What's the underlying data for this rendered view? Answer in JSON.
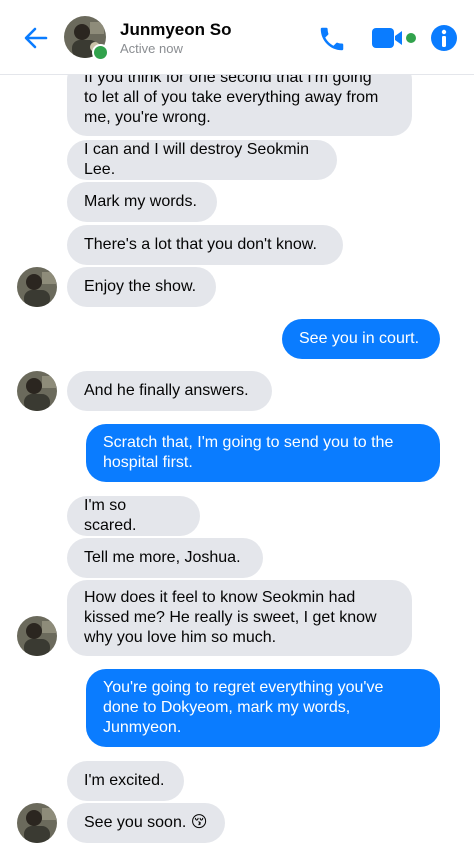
{
  "header": {
    "name": "Junmyeon So",
    "status": "Active now",
    "back_icon": "back-arrow-icon",
    "call_icon": "phone-icon",
    "video_icon": "video-camera-icon",
    "info_icon": "info-icon"
  },
  "colors": {
    "accent": "#0a7cff",
    "incoming_bubble": "#e4e6eb",
    "online": "#31a24c"
  },
  "messages": [
    {
      "side": "in",
      "text": "If you think for one second that I'm going\nto let all of you take everything away from\nme, you're wrong."
    },
    {
      "side": "in",
      "text": "I can and I will destroy Seokmin Lee."
    },
    {
      "side": "in",
      "text": "Mark my words."
    },
    {
      "side": "in",
      "text": "There's a lot that you don't know."
    },
    {
      "side": "in",
      "text": "Enjoy the show."
    },
    {
      "side": "out",
      "text": "See you in court."
    },
    {
      "side": "in",
      "text": "And he finally answers."
    },
    {
      "side": "out",
      "text": "Scratch that, I'm going to send you to the\nhospital first."
    },
    {
      "side": "in",
      "text": "I'm so scared."
    },
    {
      "side": "in",
      "text": "Tell me more, Joshua."
    },
    {
      "side": "in",
      "text": "How does it feel to know Seokmin had\nkissed me? He really is sweet, I get know\nwhy you love him so much."
    },
    {
      "side": "out",
      "text": "You're going to regret everything you've\ndone to Dokyeom, mark my words,\nJunmyeon."
    },
    {
      "side": "in",
      "text": "I'm excited."
    },
    {
      "side": "in",
      "text": "See you soon. 😚"
    }
  ]
}
